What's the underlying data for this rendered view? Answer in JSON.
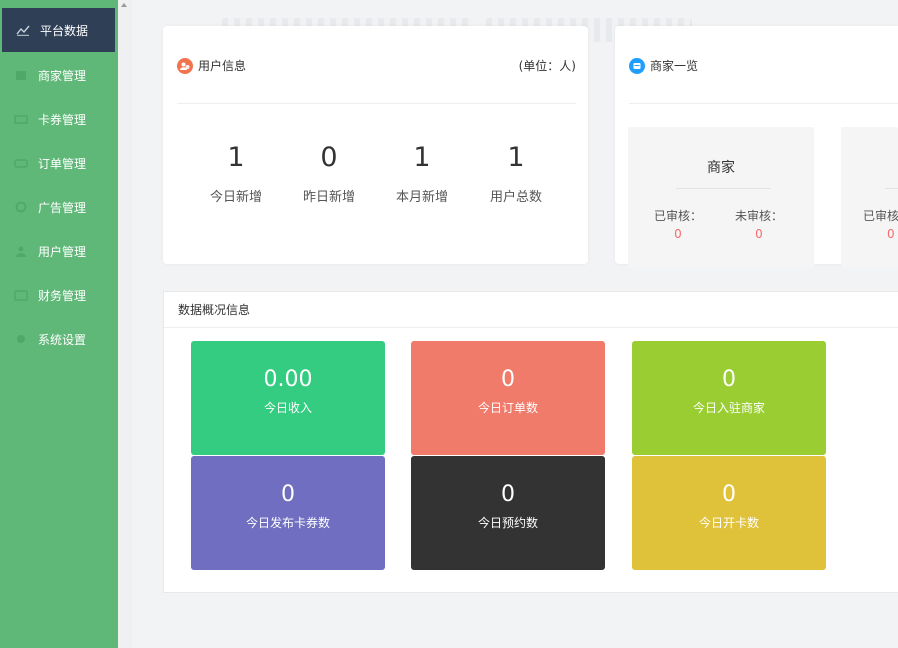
{
  "sidebar": {
    "items": [
      {
        "label": "平台数据",
        "icon": "chart-line-icon",
        "active": true
      },
      {
        "label": "商家管理",
        "icon": "store-icon"
      },
      {
        "label": "卡券管理",
        "icon": "ticket-icon"
      },
      {
        "label": "订单管理",
        "icon": "order-icon"
      },
      {
        "label": "广告管理",
        "icon": "ad-icon"
      },
      {
        "label": "用户管理",
        "icon": "user-icon"
      },
      {
        "label": "财务管理",
        "icon": "finance-icon"
      },
      {
        "label": "系统设置",
        "icon": "settings-icon"
      }
    ],
    "color": "#5fb878",
    "active_color": "#2f4056"
  },
  "user_info": {
    "title": "用户信息",
    "unit": "(单位：人)",
    "stats": [
      {
        "value": "1",
        "label": "今日新增"
      },
      {
        "value": "0",
        "label": "昨日新增"
      },
      {
        "value": "1",
        "label": "本月新增"
      },
      {
        "value": "1",
        "label": "用户总数"
      }
    ]
  },
  "merchant_overview": {
    "title": "商家一览",
    "box_title": "商家",
    "approved_label": "已审核：",
    "approved_value": "0",
    "pending_label": "未审核：",
    "pending_value": "0",
    "partial_label": "已审核",
    "partial_value": "0"
  },
  "overview": {
    "title": "数据概况信息",
    "tiles": [
      {
        "value": "0.00",
        "label": "今日收入",
        "color": "#33cc80"
      },
      {
        "value": "0",
        "label": "今日订单数",
        "color": "#f07b6b"
      },
      {
        "value": "0",
        "label": "今日入驻商家",
        "color": "#9acd32"
      },
      {
        "value": "0",
        "label": "今日发布卡券数",
        "color": "#6f6ec0"
      },
      {
        "value": "0",
        "label": "今日预约数",
        "color": "#333333"
      },
      {
        "value": "0",
        "label": "今日开卡数",
        "color": "#e0c23a"
      }
    ]
  }
}
